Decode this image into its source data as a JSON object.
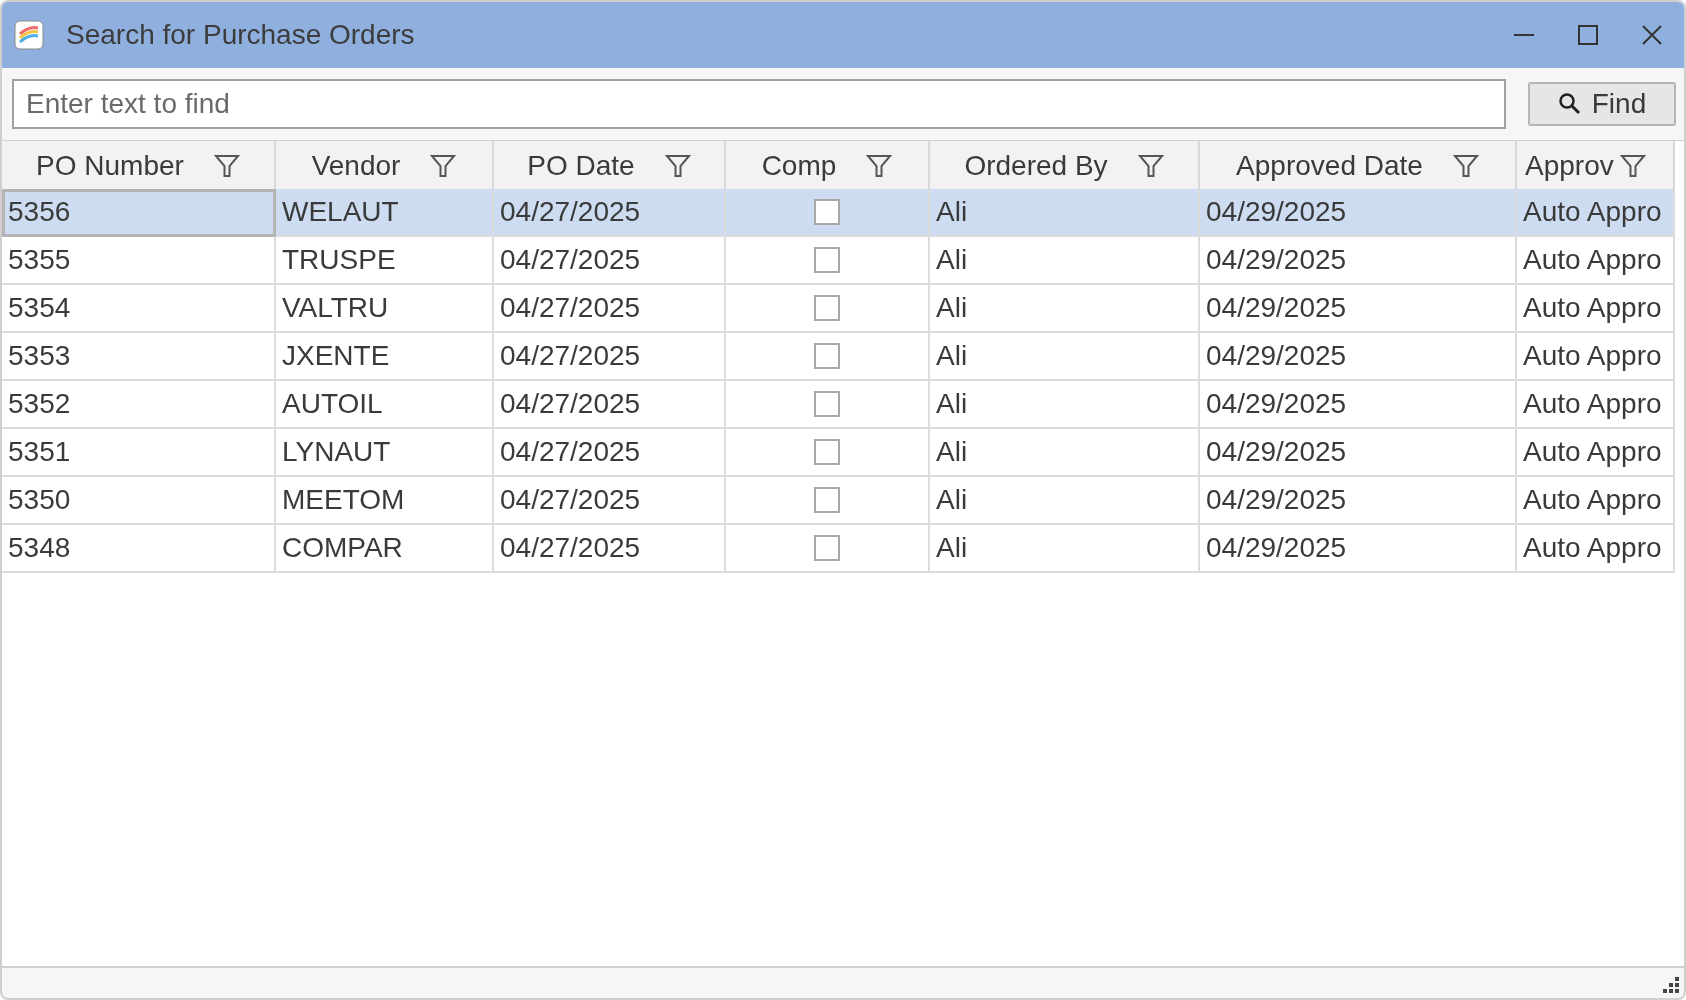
{
  "window": {
    "title": "Search for Purchase Orders"
  },
  "search": {
    "placeholder": "Enter text to find",
    "button": "Find"
  },
  "table": {
    "columns": [
      {
        "label": "PO Number",
        "kind": "text"
      },
      {
        "label": "Vendor",
        "kind": "text"
      },
      {
        "label": "PO Date",
        "kind": "text"
      },
      {
        "label": "Comp",
        "kind": "checkbox"
      },
      {
        "label": "Ordered By",
        "kind": "text"
      },
      {
        "label": "Approved Date",
        "kind": "text"
      },
      {
        "label": "Approv",
        "kind": "text"
      }
    ],
    "rows": [
      {
        "selected": true,
        "cells": [
          "5356",
          "WELAUT",
          "04/27/2025",
          false,
          "Ali",
          "04/29/2025",
          "Auto Appro"
        ]
      },
      {
        "selected": false,
        "cells": [
          "5355",
          "TRUSPE",
          "04/27/2025",
          false,
          "Ali",
          "04/29/2025",
          "Auto Appro"
        ]
      },
      {
        "selected": false,
        "cells": [
          "5354",
          "VALTRU",
          "04/27/2025",
          false,
          "Ali",
          "04/29/2025",
          "Auto Appro"
        ]
      },
      {
        "selected": false,
        "cells": [
          "5353",
          "JXENTE",
          "04/27/2025",
          false,
          "Ali",
          "04/29/2025",
          "Auto Appro"
        ]
      },
      {
        "selected": false,
        "cells": [
          "5352",
          "AUTOIL",
          "04/27/2025",
          false,
          "Ali",
          "04/29/2025",
          "Auto Appro"
        ]
      },
      {
        "selected": false,
        "cells": [
          "5351",
          "LYNAUT",
          "04/27/2025",
          false,
          "Ali",
          "04/29/2025",
          "Auto Appro"
        ]
      },
      {
        "selected": false,
        "cells": [
          "5350",
          "MEETOM",
          "04/27/2025",
          false,
          "Ali",
          "04/29/2025",
          "Auto Appro"
        ]
      },
      {
        "selected": false,
        "cells": [
          "5348",
          "COMPAR",
          "04/27/2025",
          false,
          "Ali",
          "04/29/2025",
          "Auto Appro"
        ]
      }
    ]
  }
}
